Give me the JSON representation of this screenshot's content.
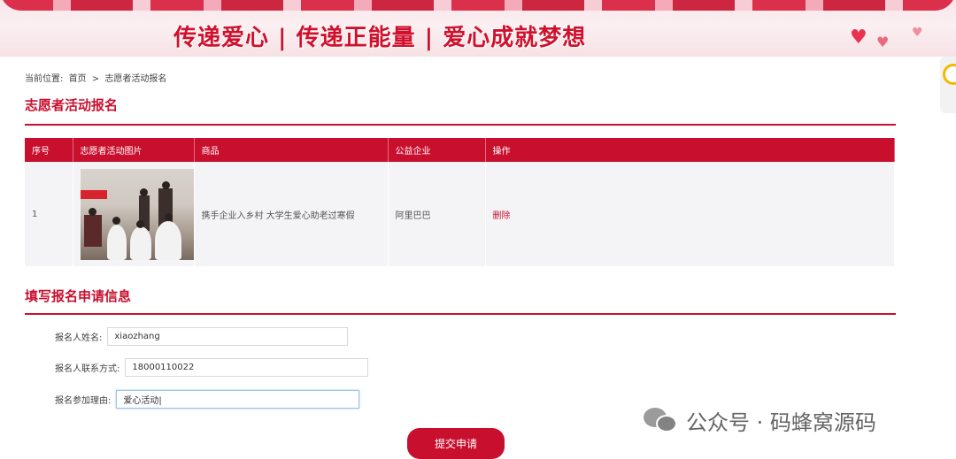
{
  "banner": {
    "slogan": "传递爱心 | 传递正能量 | 爱心成就梦想"
  },
  "breadcrumb": {
    "prefix": "当前位置:",
    "home": "首页",
    "separator": ">",
    "current": "志愿者活动报名"
  },
  "activity_section": {
    "title": "志愿者活动报名"
  },
  "table": {
    "headers": [
      "序号",
      "志愿者活动图片",
      "商品",
      "公益企业",
      "操作"
    ],
    "rows": [
      {
        "index": "1",
        "product": "携手企业入乡村 大学生爱心助老过寒假",
        "company": "阿里巴巴",
        "action": "删除"
      }
    ]
  },
  "form_section": {
    "title": "填写报名申请信息",
    "fields": [
      {
        "label": "报名人姓名:",
        "value": "xiaozhang"
      },
      {
        "label": "报名人联系方式:",
        "value": "18000110022"
      },
      {
        "label": "报名参加理由:",
        "value": "爱心活动|"
      }
    ],
    "submit_label": "提交申请"
  },
  "watermark": {
    "text": "公众号 · 码蜂窝源码"
  },
  "colors": {
    "accent": "#c8102e",
    "row_bg": "#f4f4f6"
  }
}
